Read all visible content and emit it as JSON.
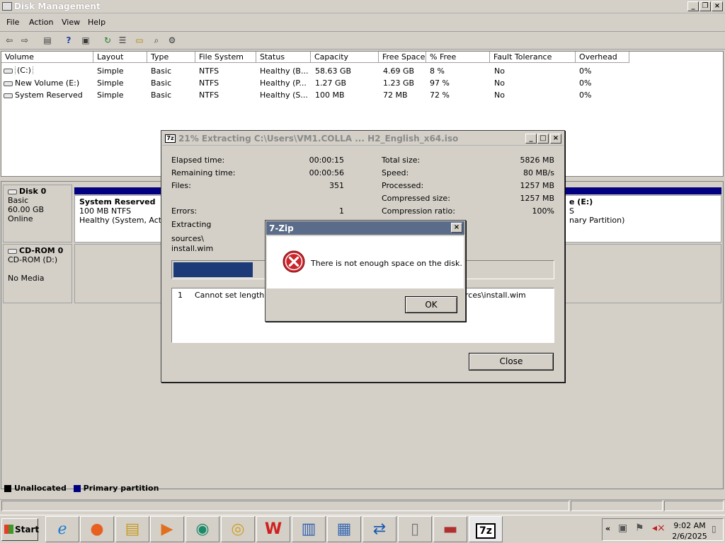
{
  "window": {
    "title": "Disk Management"
  },
  "menu": [
    "File",
    "Action",
    "View",
    "Help"
  ],
  "toolbar_icons": [
    "back-icon",
    "forward-icon",
    "view-icon",
    "help-icon",
    "view-pane-icon",
    "refresh-icon",
    "properties-icon",
    "open-icon",
    "search-icon",
    "settings-icon"
  ],
  "volume_table": {
    "headers": [
      "Volume",
      "Layout",
      "Type",
      "File System",
      "Status",
      "Capacity",
      "Free Space",
      "% Free",
      "Fault Tolerance",
      "Overhead"
    ],
    "rows": [
      [
        "(C:)",
        "Simple",
        "Basic",
        "NTFS",
        "Healthy (B...",
        "58.63 GB",
        "4.69 GB",
        "8 %",
        "No",
        "0%"
      ],
      [
        "New Volume (E:)",
        "Simple",
        "Basic",
        "NTFS",
        "Healthy (P...",
        "1.27 GB",
        "1.23 GB",
        "97 %",
        "No",
        "0%"
      ],
      [
        "System Reserved",
        "Simple",
        "Basic",
        "NTFS",
        "Healthy (S...",
        "100 MB",
        "72 MB",
        "72 %",
        "No",
        "0%"
      ]
    ]
  },
  "disks": {
    "disk0": {
      "name": "Disk 0",
      "type": "Basic",
      "size": "60.00 GB",
      "state": "Online"
    },
    "disk0_part1": {
      "name": "System Reserved",
      "info": "100 MB NTFS",
      "status": "Healthy (System, Active"
    },
    "disk0_part3": {
      "name": "e  (E:)",
      "info": "S",
      "status": "nary Partition)"
    },
    "cdrom0": {
      "name": "CD-ROM 0",
      "type": "CD-ROM (D:)",
      "state": "No Media"
    }
  },
  "legend": {
    "unallocated": "Unallocated",
    "primary": "Primary partition"
  },
  "progress": {
    "title": "21% Extracting C:\\Users\\VM1.COLLA ... H2_English_x64.iso",
    "title_icon": "7z",
    "elapsed_label": "Elapsed time:",
    "elapsed_value": "00:00:15",
    "remaining_label": "Remaining time:",
    "remaining_value": "00:00:56",
    "files_label": "Files:",
    "files_value": "351",
    "errors_label": "Errors:",
    "errors_value": "1",
    "total_label": "Total size:",
    "total_value": "5826 MB",
    "speed_label": "Speed:",
    "speed_value": "80 MB/s",
    "processed_label": "Processed:",
    "processed_value": "1257 MB",
    "compressed_label": "Compressed size:",
    "compressed_value": "1257 MB",
    "ratio_label": "Compression ratio:",
    "ratio_value": "100%",
    "extracting_label": "Extracting",
    "path_line1": "sources\\",
    "path_line2": "install.wim",
    "percent": 21,
    "error_index": "1",
    "error_text": "Cannot set length for",
    "error_text_tail": "rces\\install.wim",
    "close_label": "Close"
  },
  "message_box": {
    "title": "7-Zip",
    "text": "There is not enough space on the disk.",
    "ok_label": "OK"
  },
  "taskbar": {
    "start_label": "Start",
    "apps": [
      "ie-icon",
      "firefox-icon",
      "explorer-icon",
      "media-player-icon",
      "chat-icon",
      "chrome-icon",
      "wps-icon",
      "winrar-icon",
      "computer-management-icon",
      "file-transfer-icon",
      "document-icon",
      "toolbox-icon",
      "7zip-icon"
    ],
    "app_7zip_label": "7z",
    "clock_time": "9:02 AM",
    "clock_date": "2/6/2025"
  }
}
